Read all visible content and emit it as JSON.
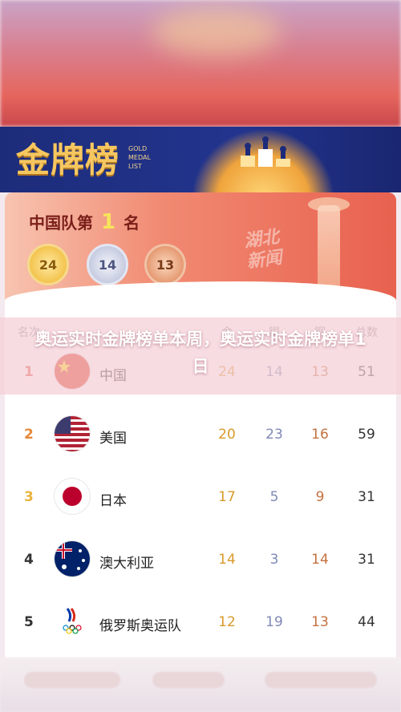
{
  "banner": {
    "title": "金牌榜",
    "subtitle": "GOLD\nMEDAL\nLIST"
  },
  "hero": {
    "prefix": "中国队第",
    "rank": "1",
    "suffix": "名",
    "gold": "24",
    "silver": "14",
    "bronze": "13",
    "watermark": "湖北\n新闻"
  },
  "columns": {
    "rank": "名次",
    "gold": "金",
    "silver": "银",
    "bronze": "铜",
    "total": "总数"
  },
  "overlay": {
    "text": "奥运实时金牌榜单本周，奥运实时金牌榜单1日"
  },
  "rows": [
    {
      "rank": "1",
      "country": "中国",
      "gold": "24",
      "silver": "14",
      "bronze": "13",
      "total": "51",
      "rank_color": "#e24a3b",
      "flag": "china-flag-icon"
    },
    {
      "rank": "2",
      "country": "美国",
      "gold": "20",
      "silver": "23",
      "bronze": "16",
      "total": "59",
      "rank_color": "#e8883a",
      "flag": "usa-flag-icon"
    },
    {
      "rank": "3",
      "country": "日本",
      "gold": "17",
      "silver": "5",
      "bronze": "9",
      "total": "31",
      "rank_color": "#eab33a",
      "flag": "japan-flag-icon"
    },
    {
      "rank": "4",
      "country": "澳大利亚",
      "gold": "14",
      "silver": "3",
      "bronze": "14",
      "total": "31",
      "rank_color": "#333333",
      "flag": "australia-flag-icon"
    },
    {
      "rank": "5",
      "country": "俄罗斯奥运队",
      "gold": "12",
      "silver": "19",
      "bronze": "13",
      "total": "44",
      "rank_color": "#333333",
      "flag": "roc-flag-icon"
    }
  ],
  "colors": {
    "banner_blue": "#22348e",
    "gold_accent": "#f6c760",
    "gold_text": "#d99a2b",
    "silver_text": "#7f89b6",
    "bronze_text": "#c4713f"
  }
}
